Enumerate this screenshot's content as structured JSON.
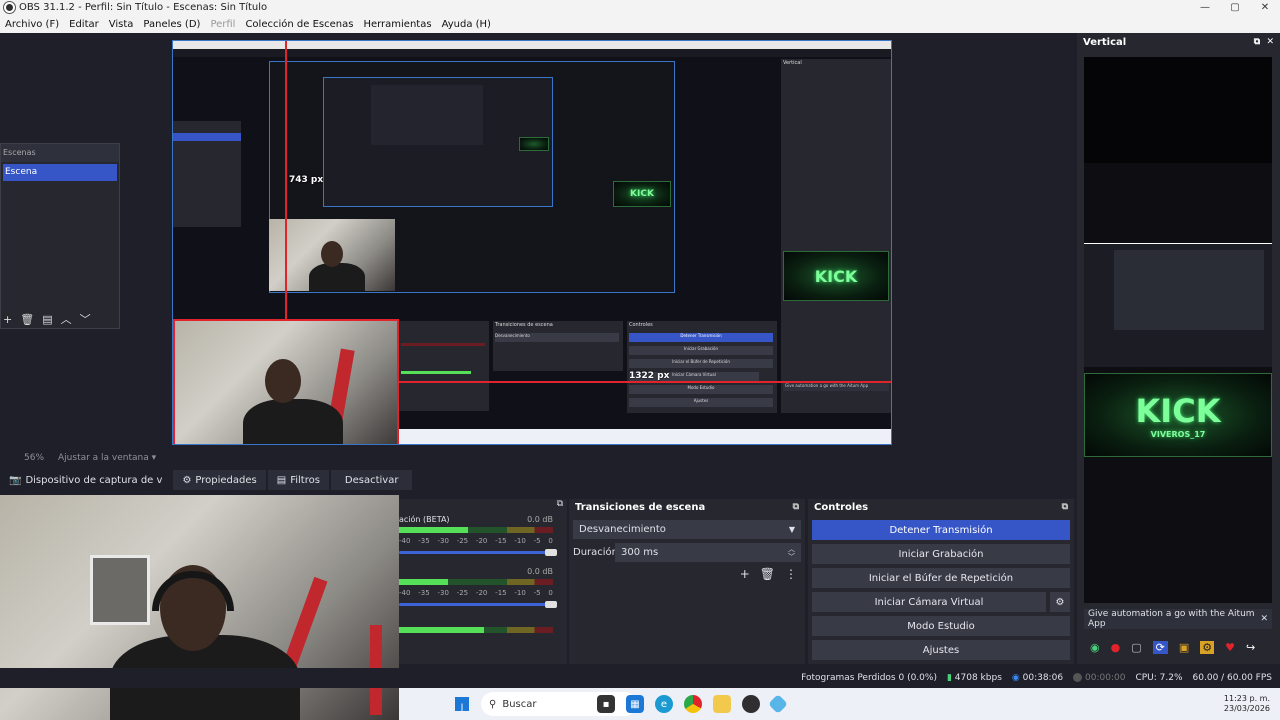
{
  "window": {
    "title": "OBS 31.1.2 - Perfil: Sin Título - Escenas: Sin Título",
    "minimize": "—",
    "maximize": "▢",
    "close": "✕"
  },
  "menu": {
    "items": [
      {
        "label": "Archivo (F)",
        "enabled": true
      },
      {
        "label": "Editar",
        "enabled": true
      },
      {
        "label": "Vista",
        "enabled": true
      },
      {
        "label": "Paneles (D)",
        "enabled": true
      },
      {
        "label": "Perfil",
        "enabled": false
      },
      {
        "label": "Colección de Escenas",
        "enabled": true
      },
      {
        "label": "Herramientas",
        "enabled": true
      },
      {
        "label": "Ayuda (H)",
        "enabled": true
      }
    ]
  },
  "scenes_dock": {
    "title": "Escenas",
    "items": [
      "Escena"
    ],
    "toolbar": {
      "add": "+",
      "remove": "🗑",
      "filter": "▤",
      "up": "︿",
      "down": "﹀"
    }
  },
  "preview": {
    "measure_height": "743 px",
    "measure_width": "1322 px",
    "kick_text": "KICK",
    "vertical_label": "Vertical"
  },
  "zoom": {
    "value": "56%",
    "fit_label": "Ajustar a la ventana"
  },
  "source_toolbar": {
    "source_name": "Dispositivo de captura de v",
    "properties": "Propiedades",
    "filters": "Filtros",
    "deactivate": "Desactivar"
  },
  "mixer": {
    "channels": [
      {
        "label": "ación (BETA)",
        "db": "0.0 dB",
        "level": 0.45
      },
      {
        "label": "",
        "db": "0.0 dB",
        "level": 0.32
      },
      {
        "label": "",
        "db": "",
        "level": 0.55
      }
    ],
    "scale": [
      "-40",
      "-35",
      "-30",
      "-25",
      "-20",
      "-15",
      "-10",
      "-5",
      "0"
    ],
    "float_icon": "⧉"
  },
  "transitions": {
    "title": "Transiciones de escena",
    "selected": "Desvanecimiento",
    "duration_label": "Duración",
    "duration_value": "300 ms",
    "add": "+",
    "remove": "🗑",
    "menu": "⋮"
  },
  "controls": {
    "title": "Controles",
    "buttons": [
      {
        "label": "Detener Transmisión",
        "active": true
      },
      {
        "label": "Iniciar Grabación",
        "active": false
      },
      {
        "label": "Iniciar el Búfer de Repetición",
        "active": false
      },
      {
        "label": "Iniciar Cámara Virtual",
        "active": false
      },
      {
        "label": "Modo Estudio",
        "active": false
      },
      {
        "label": "Ajustes",
        "active": false
      }
    ]
  },
  "vertical": {
    "title": "Vertical",
    "aitum_banner": "Give automation a go with the Aitum App",
    "kick_subtext": "VIVEROS_17"
  },
  "status": {
    "dropped_frames": "Fotogramas Perdidos 0 (0.0%)",
    "bitrate": "4708 kbps",
    "stream_time": "00:38:06",
    "record_time": "00:00:00",
    "cpu": "CPU: 7.2%",
    "fps": "60.00 / 60.00 FPS"
  },
  "taskbar": {
    "search": "Buscar",
    "time": "11:23 p. m.",
    "date": "23/03/2026"
  },
  "colors": {
    "accent": "#3656c8",
    "selection_red": "#e1232b",
    "panel": "#26272f",
    "background": "#1e1f29"
  }
}
